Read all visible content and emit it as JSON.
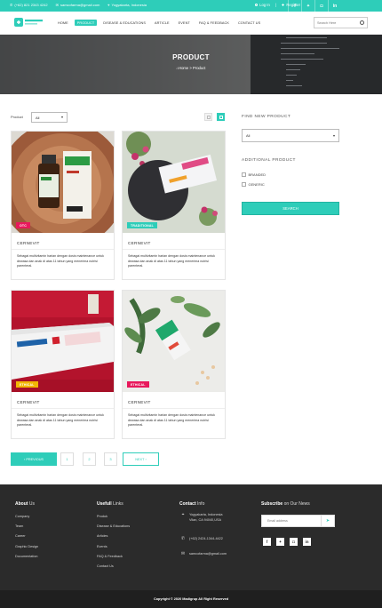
{
  "topbar": {
    "phone": "(+62) 821 2343 4242",
    "email": "samcofarma@gmail.com",
    "location": "Yogyakarta, Indonesia",
    "login": "Log In",
    "register": "Register",
    "social_icons": [
      "facebook-icon",
      "twitter-icon",
      "instagram-icon",
      "linkedin-icon"
    ],
    "accent": "#2ecdb9"
  },
  "nav": {
    "items": [
      "HOME",
      "PRODUCT",
      "DISEASE & EDUCATIONS",
      "ARTICLE",
      "EVENT",
      "FAQ & FEEDBACK",
      "CONTACT US"
    ],
    "active": "PRODUCT",
    "search_placeholder": "Search Here"
  },
  "hero": {
    "title": "PRODUCT",
    "crumb_home": "Home",
    "crumb_sep": ">",
    "crumb_current": "Product"
  },
  "filter": {
    "label": "Product",
    "selected": "All"
  },
  "products": [
    {
      "badge": "OTC",
      "badge_color": "#e8195c",
      "name": "CERNEVIT",
      "desc": "Sebagai multivitamin harian dengan dosis maintenance untuk dewasa dan anak di atas 11 tahun yang menerima nutrisi parenteral."
    },
    {
      "badge": "TRADITIONAL",
      "badge_color": "#2ecdb9",
      "name": "CERNEVIT",
      "desc": "Sebagai multivitamin harian dengan dosis maintenance untuk dewasa dan anak di atas 11 tahun yang menerima nutrisi parenteral."
    },
    {
      "badge": "ETHICAL",
      "badge_color": "#f2b705",
      "name": "CERNEVIT",
      "desc": "Sebagai multivitamin harian dengan dosis maintenance untuk dewasa dan anak di atas 11 tahun yang menerima nutrisi parenteral."
    },
    {
      "badge": "ETHICAL",
      "badge_color": "#e8195c",
      "name": "CERNEVIT",
      "desc": "Sebagai multivitamin harian dengan dosis maintenance untuk dewasa dan anak di atas 11 tahun yang menerima nutrisi parenteral."
    }
  ],
  "pagination": {
    "previous": "PREVIOUS",
    "pages": [
      "1",
      "2",
      "3"
    ],
    "next": "NEXT"
  },
  "sidebar": {
    "find_title": "FIND NEW PRODUCT",
    "find_selected": "All",
    "additional_title": "ADDITIONAL PRODUCT",
    "options": [
      "BRANDED",
      "GENERIC"
    ],
    "search_button": "SEARCH"
  },
  "footer": {
    "about_bold": "About",
    "about_light": "Us",
    "about_links": [
      "Company",
      "Team",
      "Career",
      "Graphic Design",
      "Documentation"
    ],
    "useful_bold": "Usefull",
    "useful_light": "Links",
    "useful_links": [
      "Produk",
      "Disease & Educations",
      "Articles",
      "Events",
      "FAQ & Feedback",
      "Contact Us"
    ],
    "contact_bold": "Contact",
    "contact_light": "Info",
    "address_line1": "Yogyakarta, Indonesia",
    "address_line2": "Vilan, CA 94040,USA",
    "phone": "(+62) 2424-1344-4422",
    "email": "samcofarma@gmail.com",
    "subscribe_bold": "Subscribe",
    "subscribe_light": "on Our News",
    "email_placeholder": "Email address",
    "copyright": "Copyright © 2020 Madigrup All Right Reserved"
  }
}
